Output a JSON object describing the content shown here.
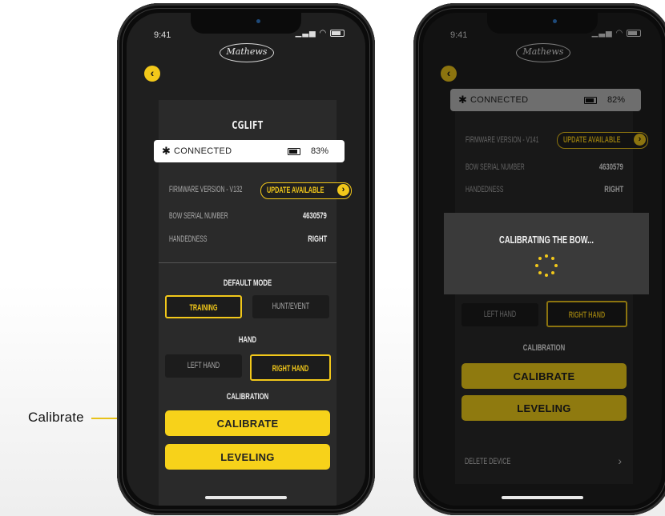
{
  "annotation": {
    "label": "Calibrate"
  },
  "status": {
    "time": "9:41",
    "icons": "…•• ◠"
  },
  "brand": {
    "logo_text": "Mathews"
  },
  "accent_color": "#f2c81a",
  "left_screen": {
    "device_name": "CGLIFT",
    "connection": {
      "status": "CONNECTED",
      "battery": "83%"
    },
    "firmware_label": "FIRMWARE VERSION - V132",
    "update_label": "UPDATE AVAILABLE",
    "serial_label": "BOW SERIAL NUMBER",
    "serial_value": "4630579",
    "handedness_label": "HANDEDNESS",
    "handedness_value": "RIGHT",
    "default_mode_title": "DEFAULT MODE",
    "modes": [
      "TRAINING",
      "HUNT/EVENT"
    ],
    "selected_mode": "TRAINING",
    "hand_title": "HAND",
    "hands": [
      "LEFT HAND",
      "RIGHT HAND"
    ],
    "selected_hand": "RIGHT HAND",
    "calibration_title": "CALIBRATION",
    "calibrate_label": "CALIBRATE",
    "leveling_label": "LEVELING"
  },
  "right_screen": {
    "connection": {
      "status": "CONNECTED",
      "battery": "82%"
    },
    "firmware_label": "FIRMWARE VERSION - V141",
    "update_label": "UPDATE AVAILABLE",
    "serial_label": "BOW SERIAL NUMBER",
    "serial_value": "4630579",
    "handedness_label": "HANDEDNESS",
    "handedness_value": "RIGHT",
    "hands": [
      "LEFT HAND",
      "RIGHT HAND"
    ],
    "calibration_title": "CALIBRATION",
    "calibrate_label": "CALIBRATE",
    "leveling_label": "LEVELING",
    "delete_label": "DELETE DEVICE",
    "dialog_text": "CALIBRATING THE BOW..."
  }
}
